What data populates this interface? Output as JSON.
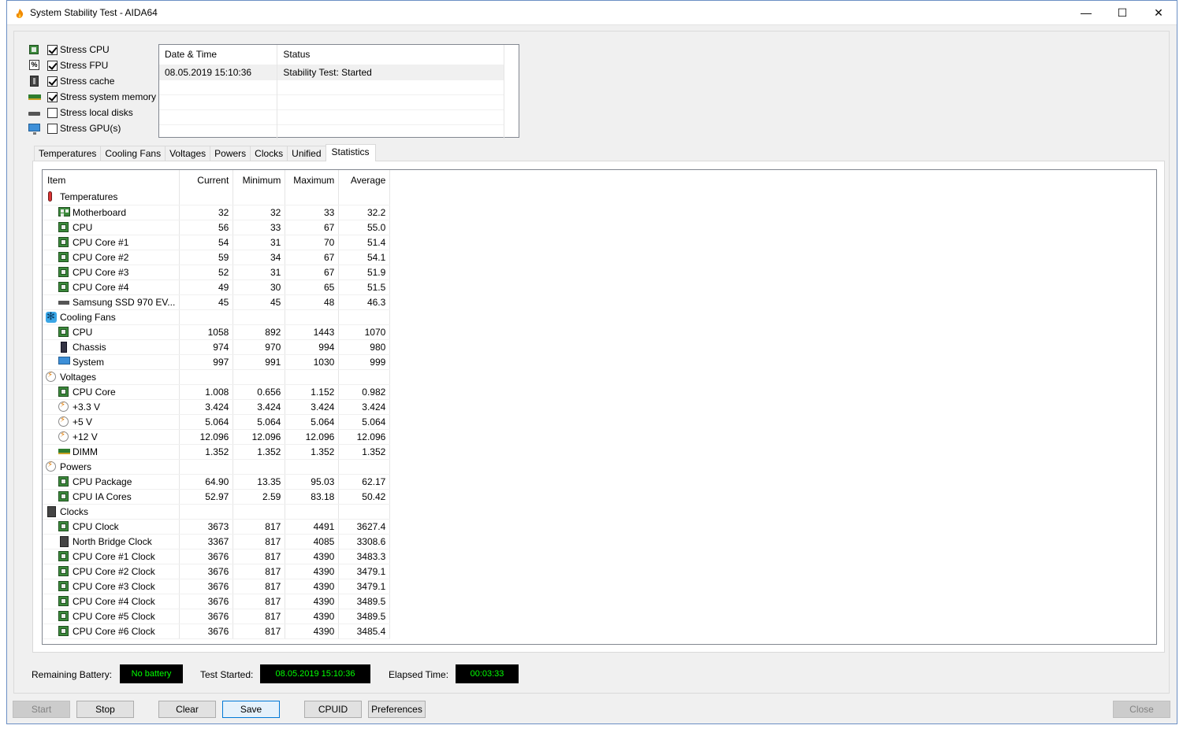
{
  "window": {
    "title": "System Stability Test - AIDA64",
    "minimize": "—",
    "maximize": "☐",
    "close": "✕"
  },
  "stress": [
    {
      "label": "Stress CPU",
      "checked": true,
      "icon": "cpu-icon"
    },
    {
      "label": "Stress FPU",
      "checked": true,
      "icon": "fpu-icon"
    },
    {
      "label": "Stress cache",
      "checked": true,
      "icon": "cache-icon"
    },
    {
      "label": "Stress system memory",
      "checked": true,
      "icon": "memory-icon"
    },
    {
      "label": "Stress local disks",
      "checked": false,
      "icon": "disk-icon"
    },
    {
      "label": "Stress GPU(s)",
      "checked": false,
      "icon": "gpu-icon"
    }
  ],
  "fpu_icon_glyph": "%",
  "status_log": {
    "headers": [
      "Date & Time",
      "Status"
    ],
    "rows": [
      [
        "08.05.2019 15:10:36",
        "Stability Test: Started"
      ]
    ]
  },
  "tabs": [
    "Temperatures",
    "Cooling Fans",
    "Voltages",
    "Powers",
    "Clocks",
    "Unified",
    "Statistics"
  ],
  "active_tab": "Statistics",
  "stats": {
    "headers": [
      "Item",
      "Current",
      "Minimum",
      "Maximum",
      "Average"
    ],
    "rows": [
      {
        "group": true,
        "icon": "thermometer",
        "item": "Temperatures",
        "cur": "",
        "min": "",
        "max": "",
        "avg": ""
      },
      {
        "icon": "motherboard",
        "item": "Motherboard",
        "cur": "32",
        "min": "32",
        "max": "33",
        "avg": "32.2"
      },
      {
        "icon": "chip",
        "item": "CPU",
        "cur": "56",
        "min": "33",
        "max": "67",
        "avg": "55.0"
      },
      {
        "icon": "chip",
        "item": "CPU Core #1",
        "cur": "54",
        "min": "31",
        "max": "70",
        "avg": "51.4"
      },
      {
        "icon": "chip",
        "item": "CPU Core #2",
        "cur": "59",
        "min": "34",
        "max": "67",
        "avg": "54.1"
      },
      {
        "icon": "chip",
        "item": "CPU Core #3",
        "cur": "52",
        "min": "31",
        "max": "67",
        "avg": "51.9"
      },
      {
        "icon": "chip",
        "item": "CPU Core #4",
        "cur": "49",
        "min": "30",
        "max": "65",
        "avg": "51.5"
      },
      {
        "icon": "ssd",
        "item": "Samsung SSD 970 EV...",
        "cur": "45",
        "min": "45",
        "max": "48",
        "avg": "46.3"
      },
      {
        "group": true,
        "icon": "fan",
        "item": "Cooling Fans",
        "cur": "",
        "min": "",
        "max": "",
        "avg": ""
      },
      {
        "icon": "chip",
        "item": "CPU",
        "cur": "1058",
        "min": "892",
        "max": "1443",
        "avg": "1070"
      },
      {
        "icon": "case",
        "item": "Chassis",
        "cur": "974",
        "min": "970",
        "max": "994",
        "avg": "980"
      },
      {
        "icon": "monitor",
        "item": "System",
        "cur": "997",
        "min": "991",
        "max": "1030",
        "avg": "999"
      },
      {
        "group": true,
        "icon": "voltage",
        "item": "Voltages",
        "cur": "",
        "min": "",
        "max": "",
        "avg": ""
      },
      {
        "icon": "chip",
        "item": "CPU Core",
        "cur": "1.008",
        "min": "0.656",
        "max": "1.152",
        "avg": "0.982"
      },
      {
        "icon": "voltage",
        "item": "+3.3 V",
        "cur": "3.424",
        "min": "3.424",
        "max": "3.424",
        "avg": "3.424"
      },
      {
        "icon": "voltage",
        "item": "+5 V",
        "cur": "5.064",
        "min": "5.064",
        "max": "5.064",
        "avg": "5.064"
      },
      {
        "icon": "voltage",
        "item": "+12 V",
        "cur": "12.096",
        "min": "12.096",
        "max": "12.096",
        "avg": "12.096"
      },
      {
        "icon": "ram",
        "item": "DIMM",
        "cur": "1.352",
        "min": "1.352",
        "max": "1.352",
        "avg": "1.352"
      },
      {
        "group": true,
        "icon": "voltage",
        "item": "Powers",
        "cur": "",
        "min": "",
        "max": "",
        "avg": ""
      },
      {
        "icon": "chip",
        "item": "CPU Package",
        "cur": "64.90",
        "min": "13.35",
        "max": "95.03",
        "avg": "62.17"
      },
      {
        "icon": "chip",
        "item": "CPU IA Cores",
        "cur": "52.97",
        "min": "2.59",
        "max": "83.18",
        "avg": "50.42"
      },
      {
        "group": true,
        "icon": "clock",
        "item": "Clocks",
        "cur": "",
        "min": "",
        "max": "",
        "avg": ""
      },
      {
        "icon": "chip",
        "item": "CPU Clock",
        "cur": "3673",
        "min": "817",
        "max": "4491",
        "avg": "3627.4"
      },
      {
        "icon": "northbridge",
        "item": "North Bridge Clock",
        "cur": "3367",
        "min": "817",
        "max": "4085",
        "avg": "3308.6"
      },
      {
        "icon": "chip",
        "item": "CPU Core #1 Clock",
        "cur": "3676",
        "min": "817",
        "max": "4390",
        "avg": "3483.3"
      },
      {
        "icon": "chip",
        "item": "CPU Core #2 Clock",
        "cur": "3676",
        "min": "817",
        "max": "4390",
        "avg": "3479.1"
      },
      {
        "icon": "chip",
        "item": "CPU Core #3 Clock",
        "cur": "3676",
        "min": "817",
        "max": "4390",
        "avg": "3479.1"
      },
      {
        "icon": "chip",
        "item": "CPU Core #4 Clock",
        "cur": "3676",
        "min": "817",
        "max": "4390",
        "avg": "3489.5"
      },
      {
        "icon": "chip",
        "item": "CPU Core #5 Clock",
        "cur": "3676",
        "min": "817",
        "max": "4390",
        "avg": "3489.5"
      },
      {
        "icon": "chip",
        "item": "CPU Core #6 Clock",
        "cur": "3676",
        "min": "817",
        "max": "4390",
        "avg": "3485.4"
      }
    ]
  },
  "info": {
    "battery_label": "Remaining Battery:",
    "battery_value": "No battery",
    "started_label": "Test Started:",
    "started_value": "08.05.2019 15:10:36",
    "elapsed_label": "Elapsed Time:",
    "elapsed_value": "00:03:33"
  },
  "buttons": {
    "start": "Start",
    "stop": "Stop",
    "clear": "Clear",
    "save": "Save",
    "cpuid": "CPUID",
    "preferences": "Preferences",
    "close": "Close"
  },
  "colors": {
    "lcd_bg": "#000000",
    "lcd_text": "#00ff00",
    "accent": "#0078d7"
  }
}
